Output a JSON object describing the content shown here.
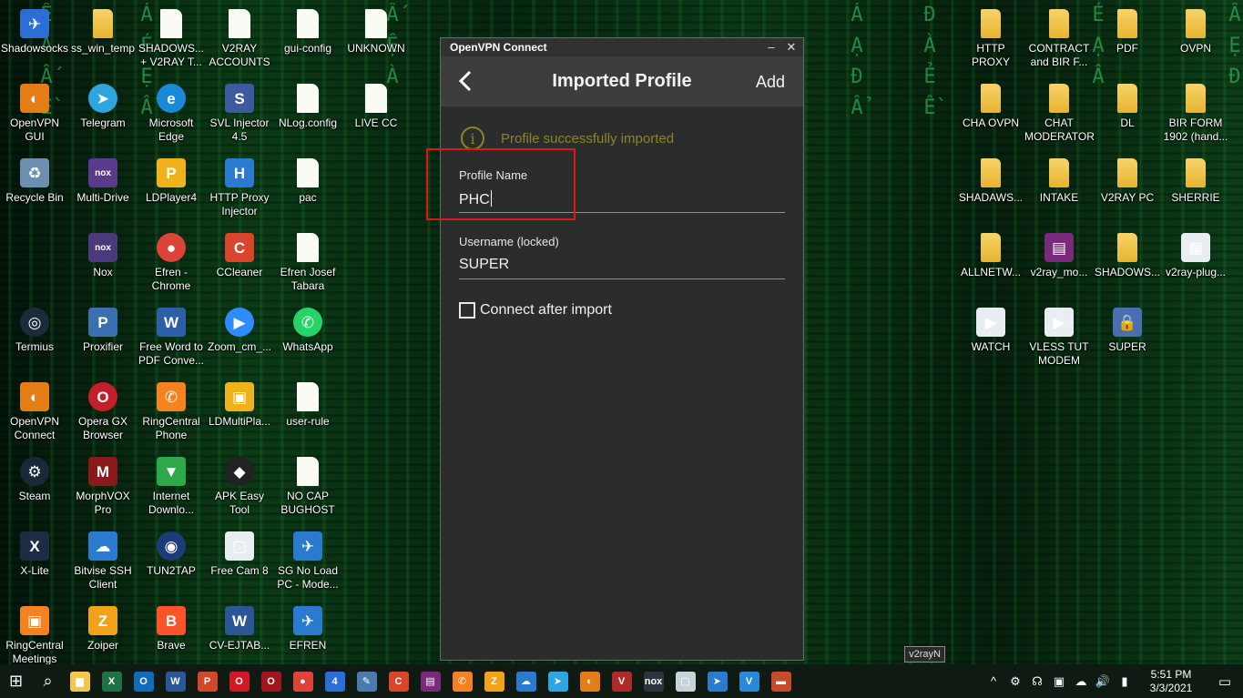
{
  "desktop": {
    "icons": [
      {
        "label": "Shadowsocks",
        "kind": "app",
        "color": "#2b6fd6",
        "glyph": "✈"
      },
      {
        "label": "ss_win_temp",
        "kind": "folder",
        "color": "",
        "glyph": ""
      },
      {
        "label": "SHADOWS... + V2RAY T...",
        "kind": "doc",
        "color": "",
        "glyph": ""
      },
      {
        "label": "V2RAY ACCOUNTS",
        "kind": "doc",
        "color": "",
        "glyph": ""
      },
      {
        "label": "gui-config",
        "kind": "doc",
        "color": "",
        "glyph": ""
      },
      {
        "label": "UNKNOWN",
        "kind": "doc",
        "color": "",
        "glyph": ""
      },
      {
        "label": "OpenVPN GUI",
        "kind": "app",
        "color": "#e57d17",
        "glyph": "◐"
      },
      {
        "label": "Telegram",
        "kind": "round",
        "color": "#2ca5e0",
        "glyph": "➤"
      },
      {
        "label": "Microsoft Edge",
        "kind": "round",
        "color": "#1a8ad8",
        "glyph": "e"
      },
      {
        "label": "SVL Injector 4.5",
        "kind": "app",
        "color": "#3d5a9e",
        "glyph": "S"
      },
      {
        "label": "NLog.config",
        "kind": "doc",
        "color": "",
        "glyph": ""
      },
      {
        "label": "LIVE CC",
        "kind": "doc",
        "color": "",
        "glyph": ""
      },
      {
        "label": "Recycle Bin",
        "kind": "app",
        "color": "#6a8fb0",
        "glyph": "♻"
      },
      {
        "label": "Multi-Drive",
        "kind": "app",
        "color": "#5a3a8a",
        "glyph": "nox"
      },
      {
        "label": "LDPlayer4",
        "kind": "app",
        "color": "#f0b21a",
        "glyph": "P"
      },
      {
        "label": "HTTP Proxy Injector",
        "kind": "app",
        "color": "#2a7bd0",
        "glyph": "H"
      },
      {
        "label": "pac",
        "kind": "doc",
        "color": "",
        "glyph": ""
      },
      {
        "label": "Nox",
        "kind": "app",
        "color": "#4a3a7a",
        "glyph": "nox"
      },
      {
        "label": "Efren - Chrome",
        "kind": "round",
        "color": "#db4437",
        "glyph": "●"
      },
      {
        "label": "CCleaner",
        "kind": "app",
        "color": "#d9442b",
        "glyph": "C"
      },
      {
        "label": "Efren Josef Tabara",
        "kind": "doc",
        "color": "",
        "glyph": ""
      },
      {
        "label": "Termius",
        "kind": "round",
        "color": "#1b2b3a",
        "glyph": "◎"
      },
      {
        "label": "Proxifier",
        "kind": "app",
        "color": "#3a6fb0",
        "glyph": "P"
      },
      {
        "label": "Free Word to PDF Conve...",
        "kind": "app",
        "color": "#2d5fa8",
        "glyph": "W"
      },
      {
        "label": "Zoom_cm_...",
        "kind": "round",
        "color": "#2d8cff",
        "glyph": "▶"
      },
      {
        "label": "WhatsApp",
        "kind": "round",
        "color": "#25d366",
        "glyph": "✆"
      },
      {
        "label": "OpenVPN Connect",
        "kind": "app",
        "color": "#e57d17",
        "glyph": "◐"
      },
      {
        "label": "Opera GX Browser",
        "kind": "round",
        "color": "#c41e2b",
        "glyph": "O"
      },
      {
        "label": "RingCentral Phone",
        "kind": "app",
        "color": "#f58220",
        "glyph": "✆"
      },
      {
        "label": "LDMultiPla...",
        "kind": "app",
        "color": "#f0b21a",
        "glyph": "▣"
      },
      {
        "label": "user-rule",
        "kind": "doc",
        "color": "",
        "glyph": ""
      },
      {
        "label": "Steam",
        "kind": "round",
        "color": "#1b2838",
        "glyph": "⚙"
      },
      {
        "label": "MorphVOX Pro",
        "kind": "app",
        "color": "#8a1a1a",
        "glyph": "M"
      },
      {
        "label": "Internet Downlo...",
        "kind": "app",
        "color": "#2da84a",
        "glyph": "▼"
      },
      {
        "label": "APK Easy Tool",
        "kind": "round",
        "color": "#222222",
        "glyph": "◆"
      },
      {
        "label": "NO CAP BUGHOST",
        "kind": "doc",
        "color": "",
        "glyph": ""
      },
      {
        "label": "X-Lite",
        "kind": "app",
        "color": "#1d2b44",
        "glyph": "X"
      },
      {
        "label": "Bitvise SSH Client",
        "kind": "app",
        "color": "#2a7bd0",
        "glyph": "☁"
      },
      {
        "label": "TUN2TAP",
        "kind": "round",
        "color": "#1c3b7a",
        "glyph": "◉"
      },
      {
        "label": "Free Cam 8",
        "kind": "app",
        "color": "#e9eef2",
        "glyph": "▢"
      },
      {
        "label": "SG No Load PC - Mode...",
        "kind": "app",
        "color": "#2a7bd0",
        "glyph": "✈"
      },
      {
        "label": "RingCentral Meetings",
        "kind": "app",
        "color": "#f58220",
        "glyph": "▣"
      },
      {
        "label": "Zoiper",
        "kind": "app",
        "color": "#f0a31a",
        "glyph": "Z"
      },
      {
        "label": "Brave",
        "kind": "app",
        "color": "#fb542b",
        "glyph": "B"
      },
      {
        "label": "CV-EJTAB...",
        "kind": "app",
        "color": "#2b5797",
        "glyph": "W"
      },
      {
        "label": "EFREN",
        "kind": "app",
        "color": "#2a7bd0",
        "glyph": "✈"
      },
      {
        "label": "HTTP PROXY INJECTOR ...",
        "kind": "folder",
        "color": "",
        "glyph": ""
      },
      {
        "label": "CONTRACT and BIR F...",
        "kind": "folder",
        "color": "",
        "glyph": ""
      },
      {
        "label": "PDF",
        "kind": "folder",
        "color": "",
        "glyph": ""
      },
      {
        "label": "OVPN",
        "kind": "folder",
        "color": "",
        "glyph": ""
      },
      {
        "label": "CHA OVPN",
        "kind": "folder",
        "color": "",
        "glyph": ""
      },
      {
        "label": "CHAT MODERATOR",
        "kind": "folder",
        "color": "",
        "glyph": ""
      },
      {
        "label": "DL",
        "kind": "folder",
        "color": "",
        "glyph": ""
      },
      {
        "label": "BIR FORM 1902 (hand...",
        "kind": "folder",
        "color": "",
        "glyph": ""
      },
      {
        "label": "SHADAWS...",
        "kind": "folder",
        "color": "",
        "glyph": ""
      },
      {
        "label": "INTAKE",
        "kind": "folder",
        "color": "",
        "glyph": ""
      },
      {
        "label": "V2RAY PC",
        "kind": "folder",
        "color": "",
        "glyph": ""
      },
      {
        "label": "SHERRIE",
        "kind": "folder",
        "color": "",
        "glyph": ""
      },
      {
        "label": "ALLNETW...",
        "kind": "folder",
        "color": "",
        "glyph": ""
      },
      {
        "label": "v2ray_mo...",
        "kind": "app",
        "color": "#7a2a7a",
        "glyph": "▤"
      },
      {
        "label": "SHADOWS...",
        "kind": "folder",
        "color": "",
        "glyph": ""
      },
      {
        "label": "v2ray-plug...",
        "kind": "app",
        "color": "#e9eef2",
        "glyph": "▦"
      },
      {
        "label": "WATCH",
        "kind": "app",
        "color": "#e9eef2",
        "glyph": "▶"
      },
      {
        "label": "VLESS TUT MODEM",
        "kind": "app",
        "color": "#e9eef2",
        "glyph": "▶"
      },
      {
        "label": "SUPER",
        "kind": "app",
        "color": "#4a6fb0",
        "glyph": "🔒"
      }
    ]
  },
  "window": {
    "title": "OpenVPN Connect",
    "minimize": "–",
    "close": "✕",
    "header_title": "Imported Profile",
    "add_label": "Add",
    "notice": "Profile successfully imported",
    "notice_icon": "i",
    "profile_name_label": "Profile Name",
    "profile_name_value": "PHC",
    "username_label": "Username (locked)",
    "username_value": "SUPER",
    "connect_after_import_label": "Connect after import",
    "connect_after_import_checked": false,
    "highlight_color": "#e0161c"
  },
  "tooltip": "v2rayN",
  "taskbar": {
    "apps": [
      {
        "name": "start-icon",
        "glyph": "⊞",
        "color": "#0f1a13"
      },
      {
        "name": "search-icon",
        "glyph": "⌕",
        "color": "#0f1a13"
      },
      {
        "name": "file-explorer-icon",
        "glyph": "▆",
        "color": "#f2c84b"
      },
      {
        "name": "excel-icon",
        "glyph": "X",
        "color": "#1f7244"
      },
      {
        "name": "outlook-icon",
        "glyph": "O",
        "color": "#0f6cbd"
      },
      {
        "name": "word-icon",
        "glyph": "W",
        "color": "#2b5797"
      },
      {
        "name": "powerpoint-icon",
        "glyph": "P",
        "color": "#d24726"
      },
      {
        "name": "opera-icon",
        "glyph": "O",
        "color": "#d11925"
      },
      {
        "name": "opera-gx-icon",
        "glyph": "O",
        "color": "#a3141c"
      },
      {
        "name": "chrome-icon",
        "glyph": "●",
        "color": "#db4437"
      },
      {
        "name": "shadowsocks-icon",
        "glyph": "4",
        "color": "#2b6fd6"
      },
      {
        "name": "notes-icon",
        "glyph": "✎",
        "color": "#4a7ab0"
      },
      {
        "name": "ccleaner-icon",
        "glyph": "C",
        "color": "#d9442b"
      },
      {
        "name": "winrar-icon",
        "glyph": "▤",
        "color": "#7a2a7a"
      },
      {
        "name": "phone-icon",
        "glyph": "✆",
        "color": "#f58220"
      },
      {
        "name": "zoiper-icon",
        "glyph": "Z",
        "color": "#f0a31a"
      },
      {
        "name": "bitvise-icon",
        "glyph": "☁",
        "color": "#2a7bd0"
      },
      {
        "name": "telegram-icon",
        "glyph": "➤",
        "color": "#2ca5e0"
      },
      {
        "name": "openvpn-icon",
        "glyph": "◐",
        "color": "#e57d17"
      },
      {
        "name": "voicemeeter-icon",
        "glyph": "V",
        "color": "#b02a2a"
      },
      {
        "name": "nox-icon",
        "glyph": "nox",
        "color": "#2c3440"
      },
      {
        "name": "freecam-icon",
        "glyph": "▢",
        "color": "#c8d2da"
      },
      {
        "name": "send-icon",
        "glyph": "➤",
        "color": "#2a7bd0"
      },
      {
        "name": "v2rayn-icon",
        "glyph": "V",
        "color": "#2a89d6"
      },
      {
        "name": "presentation-icon",
        "glyph": "▬",
        "color": "#c84a2a"
      }
    ],
    "tray": {
      "icons": [
        "^",
        "⚙",
        "☊",
        "▣",
        "☁",
        "🔊",
        "▮"
      ],
      "time": "5:51 PM",
      "date": "3/3/2021",
      "notification": "▭"
    }
  }
}
